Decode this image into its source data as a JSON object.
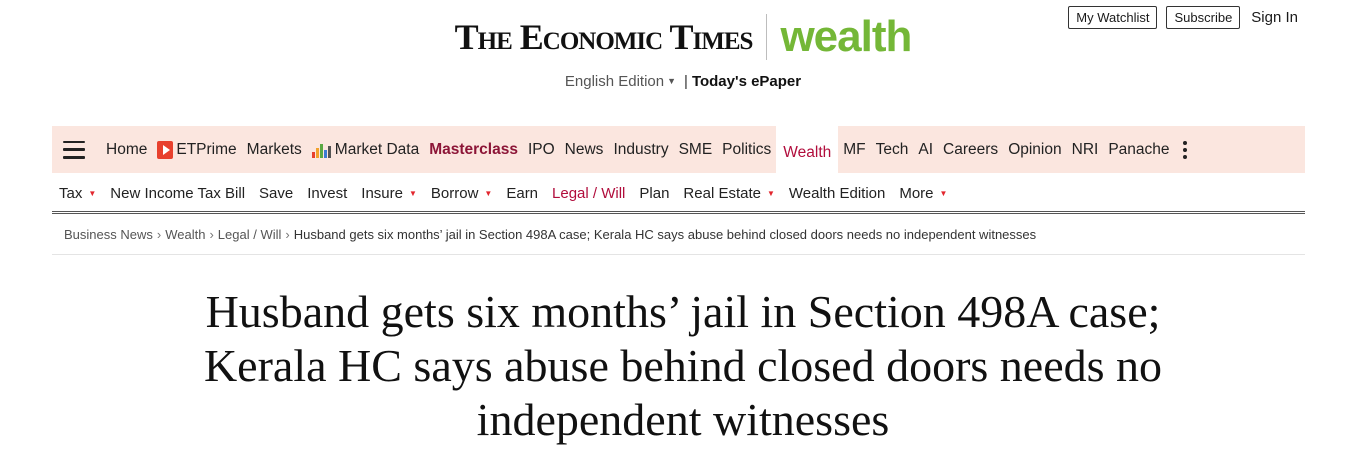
{
  "header": {
    "watchlist_label": "My Watchlist",
    "subscribe_label": "Subscribe",
    "signin_label": "Sign In",
    "logo_text": "The Economic Times",
    "section_logo_text": "wealth",
    "edition_label": "English Edition",
    "epaper_label": "Today's ePaper",
    "brand_green": "#74b737"
  },
  "main_nav": {
    "menu_icon": "hamburger-icon",
    "items": [
      {
        "label": "Home"
      },
      {
        "label": "ETPrime",
        "icon": "etprime-icon"
      },
      {
        "label": "Markets"
      },
      {
        "label": "Market Data",
        "icon": "chart-icon"
      },
      {
        "label": "Masterclass"
      },
      {
        "label": "IPO"
      },
      {
        "label": "News"
      },
      {
        "label": "Industry"
      },
      {
        "label": "SME"
      },
      {
        "label": "Politics"
      },
      {
        "label": "Wealth"
      },
      {
        "label": "MF"
      },
      {
        "label": "Tech"
      },
      {
        "label": "AI"
      },
      {
        "label": "Careers"
      },
      {
        "label": "Opinion"
      },
      {
        "label": "NRI"
      },
      {
        "label": "Panache"
      }
    ],
    "more_icon": "kebab-icon",
    "active": "Wealth",
    "background": "#fbe6df",
    "accent": "#b10d3c"
  },
  "sub_nav": {
    "items": [
      {
        "label": "Tax",
        "dropdown": true
      },
      {
        "label": "New Income Tax Bill"
      },
      {
        "label": "Save"
      },
      {
        "label": "Invest"
      },
      {
        "label": "Insure",
        "dropdown": true
      },
      {
        "label": "Borrow",
        "dropdown": true
      },
      {
        "label": "Earn"
      },
      {
        "label": "Legal / Will"
      },
      {
        "label": "Plan"
      },
      {
        "label": "Real Estate",
        "dropdown": true
      },
      {
        "label": "Wealth Edition"
      },
      {
        "label": "More",
        "dropdown": true
      }
    ],
    "active": "Legal / Will"
  },
  "breadcrumb": {
    "items": [
      "Business News",
      "Wealth",
      "Legal / Will"
    ],
    "current": "Husband gets six months’ jail in Section 498A case; Kerala HC says abuse behind closed doors needs no independent witnesses"
  },
  "article": {
    "headline": "Husband gets six months’ jail in Section 498A case; Kerala HC says abuse behind closed doors needs no independent witnesses"
  }
}
